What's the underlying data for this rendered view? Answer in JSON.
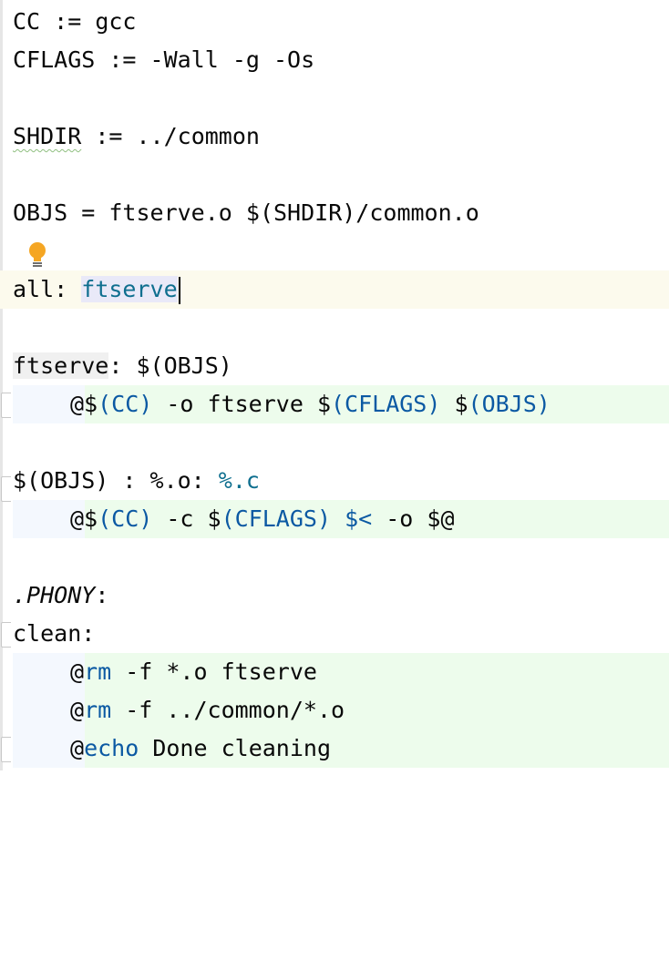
{
  "editor": {
    "line1": {
      "name": "CC",
      "op": " := ",
      "value": "gcc"
    },
    "line2": {
      "name": "CFLAGS",
      "op": " := ",
      "value": "-Wall -g -Os"
    },
    "line3": {
      "name": "SHDIR",
      "op": " := ",
      "value": "../common"
    },
    "line4": {
      "name": "OBJS",
      "op": " = ",
      "value": "ftserve.o $(SHDIR)/common.o"
    },
    "line5": {
      "target": "all",
      "colon": ": ",
      "dep": "ftserve"
    },
    "line6": {
      "target": "ftserve",
      "rest": ": $(OBJS)"
    },
    "line7": {
      "at": "@$",
      "cc": "(CC)",
      "mid": " -o ftserve $",
      "cflags": "(CFLAGS)",
      "sp": " $",
      "objs": "(OBJS)"
    },
    "line8": {
      "left": "$(OBJS) : %.o: ",
      "pattern": "%.c"
    },
    "line9": {
      "at": "@$",
      "cc": "(CC)",
      "mid": " -c $",
      "cflags": "(CFLAGS)",
      "sp": " ",
      "auto": "$<",
      "rest": " -o $@"
    },
    "line10": {
      "phony": ".PHONY",
      "colon": ":"
    },
    "line11": {
      "target": "clean:"
    },
    "line12": {
      "at": "@",
      "cmd": "rm",
      "rest": " -f *.o ftserve"
    },
    "line13": {
      "at": "@",
      "cmd": "rm",
      "rest": " -f ../common/*.o"
    },
    "line14": {
      "at": "@",
      "cmd": "echo",
      "rest": " Done cleaning"
    }
  },
  "icons": {
    "intention": "lightbulb-icon",
    "fold": "fold-marker-icon"
  },
  "colors": {
    "keyword": "#0b59a3",
    "recipe_bg": "#edfcec",
    "caret_line_bg": "#fcfaed",
    "bulb": "#f5a623"
  }
}
